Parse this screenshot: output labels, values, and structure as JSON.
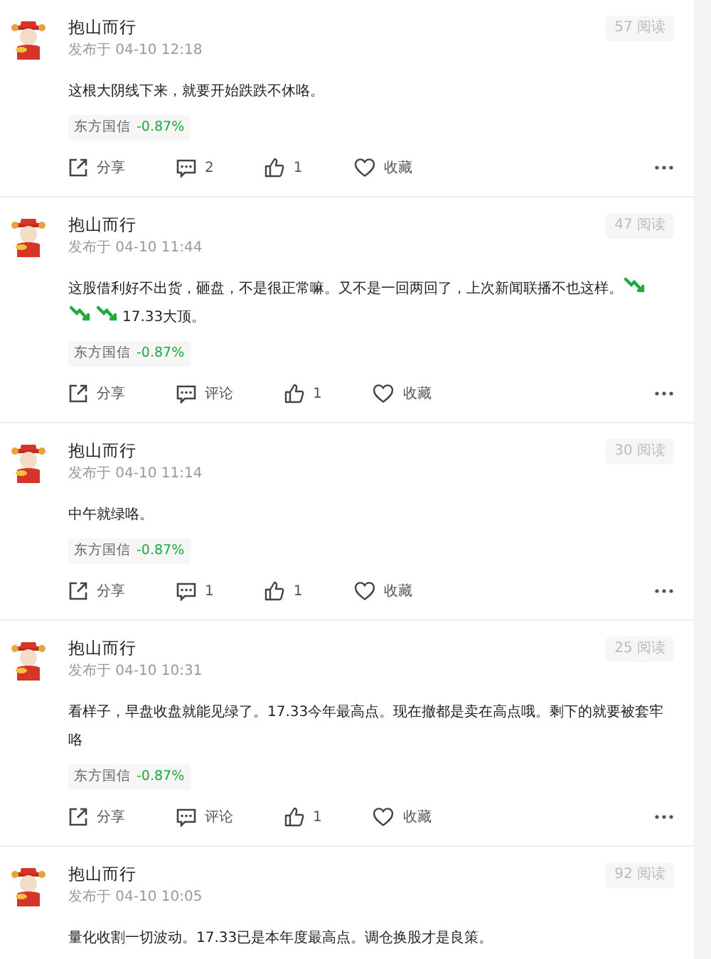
{
  "posts": [
    {
      "author": "抱山而行",
      "time": "发布于 04-10 12:18",
      "reads": "57 阅读",
      "body": [
        {
          "kind": "text",
          "text": "这根大阴线下来，就要开始跌跌不休咯。"
        }
      ],
      "stock": {
        "name": "东方国信",
        "change": "-0.87%"
      },
      "actions": {
        "share": "分享",
        "comment": "2",
        "like": "1",
        "favorite": "收藏"
      }
    },
    {
      "author": "抱山而行",
      "time": "发布于 04-10 11:44",
      "reads": "47 阅读",
      "body": [
        {
          "kind": "text",
          "text": "这股借利好不出货，砸盘，不是很正常嘛。又不是一回两回了，上次新闻联播不也这样。"
        },
        {
          "kind": "emoji"
        },
        {
          "kind": "emoji"
        },
        {
          "kind": "emoji"
        },
        {
          "kind": "text",
          "text": "17.33大顶。"
        }
      ],
      "stock": {
        "name": "东方国信",
        "change": "-0.87%"
      },
      "actions": {
        "share": "分享",
        "comment": "评论",
        "like": "1",
        "favorite": "收藏"
      }
    },
    {
      "author": "抱山而行",
      "time": "发布于 04-10 11:14",
      "reads": "30 阅读",
      "body": [
        {
          "kind": "text",
          "text": "中午就绿咯。"
        }
      ],
      "stock": {
        "name": "东方国信",
        "change": "-0.87%"
      },
      "actions": {
        "share": "分享",
        "comment": "1",
        "like": "1",
        "favorite": "收藏"
      }
    },
    {
      "author": "抱山而行",
      "time": "发布于 04-10 10:31",
      "reads": "25 阅读",
      "body": [
        {
          "kind": "text",
          "text": "看样子，早盘收盘就能见绿了。17.33今年最高点。现在撤都是卖在高点哦。剩下的就要被套牢咯"
        }
      ],
      "stock": {
        "name": "东方国信",
        "change": "-0.87%"
      },
      "actions": {
        "share": "分享",
        "comment": "评论",
        "like": "1",
        "favorite": "收藏"
      }
    },
    {
      "author": "抱山而行",
      "time": "发布于 04-10 10:05",
      "reads": "92 阅读",
      "body": [
        {
          "kind": "text",
          "text": "量化收割一切波动。17.33已是本年度最高点。调仓换股才是良策。"
        }
      ]
    }
  ]
}
